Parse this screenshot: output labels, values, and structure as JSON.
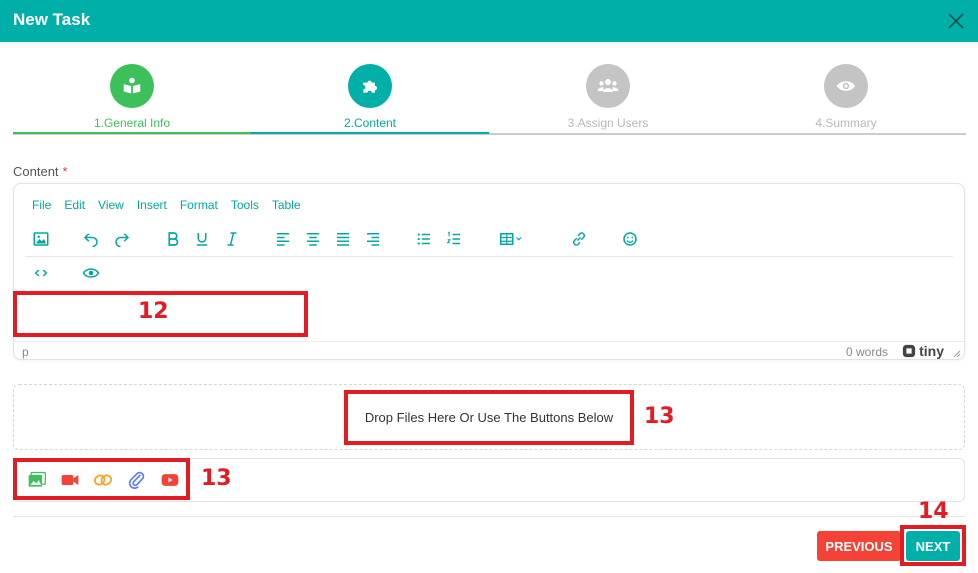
{
  "dialog": {
    "title": "New Task"
  },
  "steps": [
    {
      "label": "1.General Info",
      "icon": "book-reader-icon",
      "state": "done"
    },
    {
      "label": "2.Content",
      "icon": "puzzle-icon",
      "state": "active"
    },
    {
      "label": "3.Assign Users",
      "icon": "users-icon",
      "state": "todo"
    },
    {
      "label": "4.Summary",
      "icon": "eye-icon",
      "state": "todo"
    }
  ],
  "content": {
    "label": "Content",
    "required_mark": "*"
  },
  "editor": {
    "menu": [
      "File",
      "Edit",
      "View",
      "Insert",
      "Format",
      "Tools",
      "Table"
    ],
    "toolbar_icons": [
      "image-icon",
      "undo-icon",
      "redo-icon",
      "bold-icon",
      "underline-icon",
      "italic-icon",
      "align-left-icon",
      "align-center-icon",
      "align-justify-icon",
      "align-right-icon",
      "bullet-list-icon",
      "numbered-list-icon",
      "table-icon",
      "link-icon",
      "emoji-icon",
      "code-icon",
      "preview-icon"
    ],
    "status_path": "p",
    "word_count": "0 words",
    "brand": "tiny"
  },
  "dropzone": {
    "message": "Drop Files Here Or Use The Buttons Below"
  },
  "upload_icons": [
    "image-upload-icon",
    "video-icon",
    "link-icon",
    "attachment-icon",
    "youtube-icon"
  ],
  "buttons": {
    "previous": "PREVIOUS",
    "next": "NEXT"
  },
  "annotations": {
    "editor_area": "12",
    "dropzone": "13",
    "upload_buttons": "13",
    "next_button": "14"
  },
  "colors": {
    "primary": "#00b0a8",
    "done": "#3cc15a",
    "danger": "#f44336",
    "annotation": "#e31b23",
    "inactive": "#c4c4c4"
  }
}
